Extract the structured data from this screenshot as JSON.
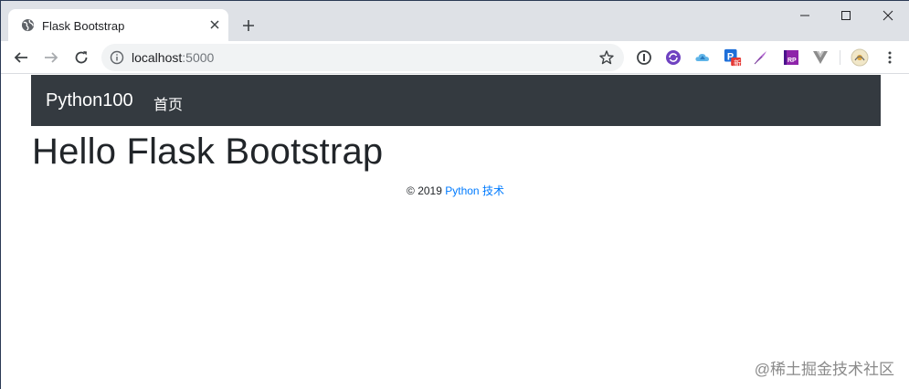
{
  "browser": {
    "tab": {
      "title": "Flask Bootstrap"
    },
    "address": {
      "host": "localhost",
      "port": ":5000"
    },
    "extensions": [
      "info-icon",
      "sync-icon",
      "cloud-icon",
      "p-badge-icon",
      "quill-icon",
      "rp-icon",
      "vue-icon",
      "avatar-icon"
    ],
    "extension_badge": "新"
  },
  "page": {
    "navbar": {
      "brand": "Python100",
      "links": [
        "首页"
      ]
    },
    "heading": "Hello Flask Bootstrap",
    "footer": {
      "copyright": "© 2019",
      "link": "Python 技术"
    },
    "watermark": "@稀土掘金技术社区"
  },
  "colors": {
    "navbar_bg": "#343a40",
    "link": "#007bff",
    "tabstrip": "#dee1e6",
    "omnibox": "#f1f3f4"
  }
}
